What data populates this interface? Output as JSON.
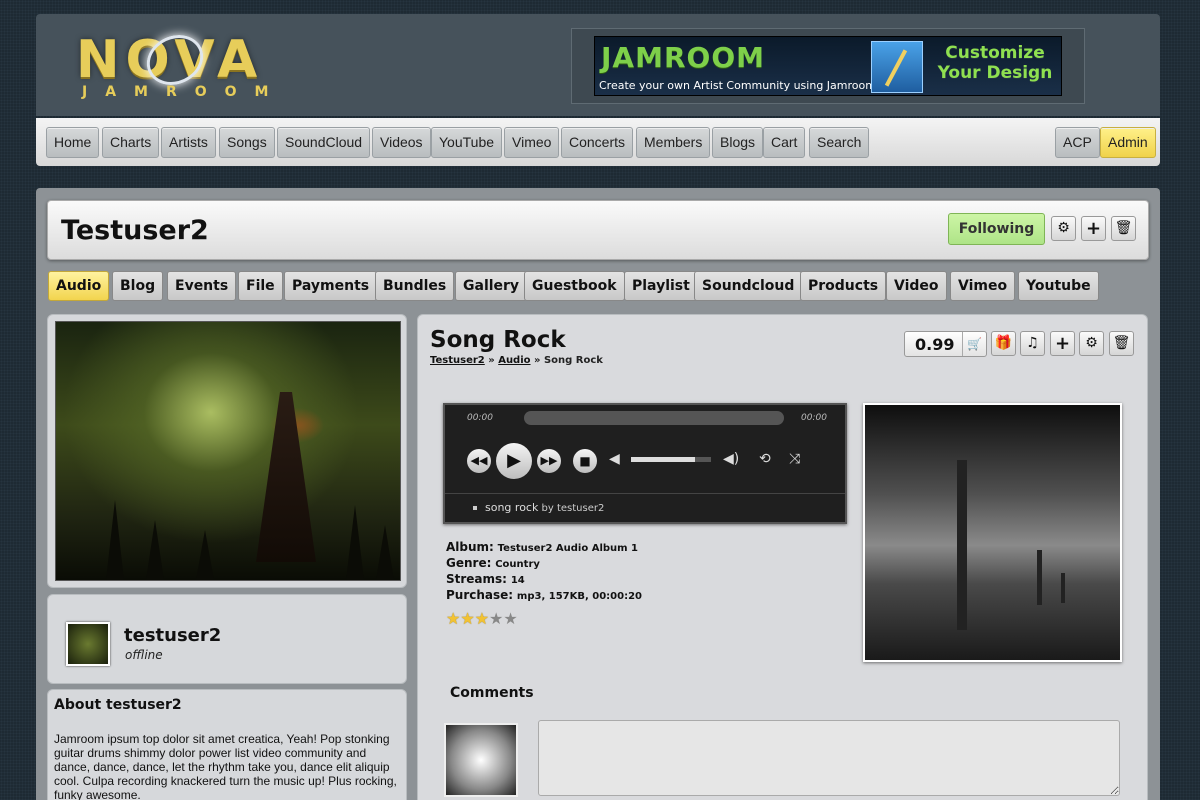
{
  "header": {
    "logo": "NOVA",
    "logo_sub": "JAMROOM",
    "banner": {
      "brand": "JAMROOM",
      "tagline": "Create your own Artist Community using Jamroom!",
      "cta": "Customize Your Design"
    }
  },
  "nav": {
    "items": [
      "Home",
      "Charts",
      "Artists",
      "Songs",
      "SoundCloud",
      "Videos",
      "YouTube",
      "Vimeo",
      "Concerts",
      "Members",
      "Blogs",
      "Cart",
      "Search"
    ],
    "acp": "ACP",
    "admin": "Admin"
  },
  "profile": {
    "name": "Testuser2",
    "follow_label": "Following",
    "icons": [
      "gear-icon",
      "plus-icon",
      "trash-icon"
    ]
  },
  "tabs": [
    "Audio",
    "Blog",
    "Events",
    "File",
    "Payments",
    "Bundles",
    "Gallery",
    "Guestbook",
    "Playlist",
    "Soundcloud",
    "Products",
    "Video",
    "Vimeo",
    "Youtube"
  ],
  "active_tab": "Audio",
  "sidebar": {
    "username": "testuser2",
    "status": "offline",
    "about_title": "About testuser2",
    "about_text": "Jamroom ipsum top dolor sit amet creatica, Yeah! Pop stonking guitar drums shimmy dolor power list video community and dance, dance, dance, let the rhythm take you, dance elit aliquip cool. Culpa recording knackered turn the music up! Plus rocking, funky awesome."
  },
  "song": {
    "title": "Song Rock",
    "breadcrumb": {
      "user": "Testuser2",
      "section": "Audio",
      "current": "Song Rock"
    },
    "price": "0.99",
    "player": {
      "time_current": "00:00",
      "time_total": "00:00",
      "volume": 0.8,
      "track": "song rock",
      "by": "by testuser2"
    },
    "meta": {
      "album_label": "Album:",
      "album": "Testuser2 Audio Album 1",
      "genre_label": "Genre:",
      "genre": "Country",
      "streams_label": "Streams:",
      "streams": "14",
      "purchase_label": "Purchase:",
      "purchase": "mp3, 157KB, 00:00:20"
    },
    "rating": 3,
    "rating_max": 5
  },
  "comments": {
    "title": "Comments",
    "placeholder": ""
  },
  "colors": {
    "accent_yellow": "#f2d44e",
    "follow_green": "#aee487",
    "logo_gold": "#e7cd5a"
  }
}
